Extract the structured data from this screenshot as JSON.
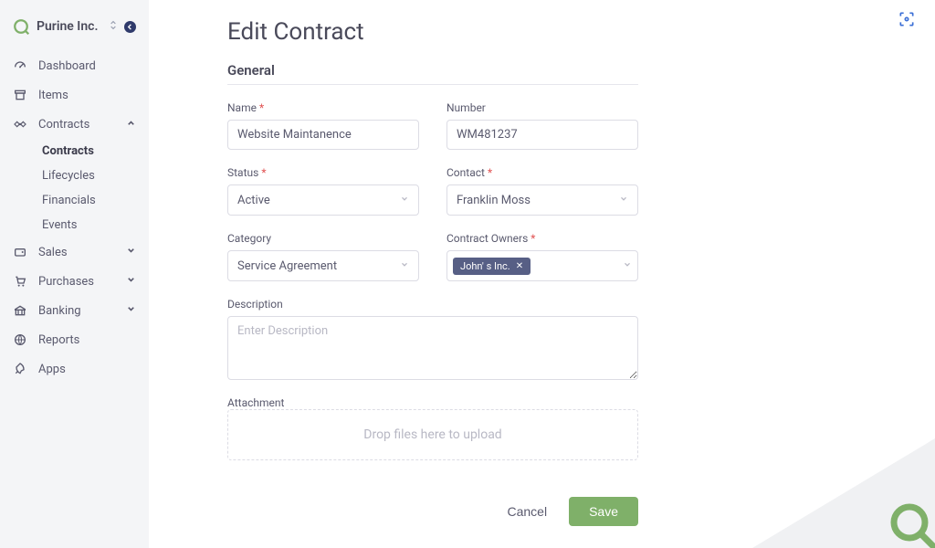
{
  "org": {
    "name": "Purine Inc."
  },
  "nav": {
    "dashboard": "Dashboard",
    "items": "Items",
    "contracts": "Contracts",
    "contracts_sub": {
      "contracts": "Contracts",
      "lifecycles": "Lifecycles",
      "financials": "Financials",
      "events": "Events"
    },
    "sales": "Sales",
    "purchases": "Purchases",
    "banking": "Banking",
    "reports": "Reports",
    "apps": "Apps"
  },
  "page": {
    "title": "Edit Contract",
    "section_general": "General"
  },
  "form": {
    "name": {
      "label": "Name",
      "value": "Website Maintanence"
    },
    "number": {
      "label": "Number",
      "value": "WM481237"
    },
    "status": {
      "label": "Status",
      "value": "Active"
    },
    "contact": {
      "label": "Contact",
      "value": "Franklin Moss"
    },
    "category": {
      "label": "Category",
      "value": "Service Agreement"
    },
    "owners": {
      "label": "Contract Owners",
      "chip": "John' s Inc."
    },
    "description": {
      "label": "Description",
      "placeholder": "Enter Description"
    },
    "attachment": {
      "label": "Attachment",
      "dropzone": "Drop files here to upload"
    }
  },
  "actions": {
    "cancel": "Cancel",
    "save": "Save"
  }
}
